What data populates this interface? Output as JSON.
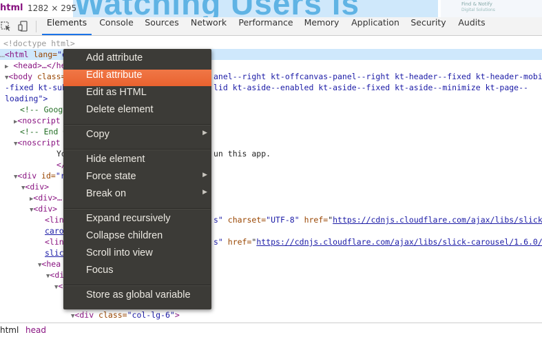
{
  "hover_tooltip": {
    "tag": "html",
    "dims": "1282 × 295"
  },
  "page_behind": {
    "headline": "Watching Users is",
    "logo_line1": "Find & Notify",
    "logo_line2": "Digital Solutions"
  },
  "toolbar": {
    "inspect_icon": "inspect-element-icon",
    "device_icon": "device-toolbar-icon",
    "tabs": [
      "Elements",
      "Console",
      "Sources",
      "Network",
      "Performance",
      "Memory",
      "Application",
      "Security",
      "Audits"
    ],
    "active_tab": "Elements"
  },
  "tree": {
    "l0": "<!doctype html>",
    "l1_tag": "<html",
    "l1_attr": " lang=",
    "l1_val": "\"en",
    "l2": "<head>…</hea",
    "l3_tag": "<body",
    "l3_attr": " class=",
    "l3_rest": "anel--right kt-offcanvas-panel--right kt-header--fixed kt-header-mobile-",
    "l4_left": "-fixed kt-sub",
    "l4_rest": "lid kt-aside--enabled kt-aside--fixed kt-aside--minimize kt-page--",
    "l5": "loading\">",
    "l6": "<!-- Googl",
    "l7": "<noscript",
    "l8": "<!-- End G",
    "l9": "<noscript",
    "l10_left": "Yo",
    "l10_rest": "un this app.",
    "l11": "</",
    "l12_tag": "<div",
    "l12_attr": " id=",
    "l12_val": "\"r",
    "l13": "<div>",
    "l14": "<div>…",
    "l15": "<div>",
    "l16_left": "<lin",
    "l16_q": "s\"",
    "l16_a1": " charset=",
    "l16_v1": "\"UTF-8\"",
    "l16_a2": " href=",
    "l16_link": "https://cdnjs.cloudflare.com/ajax/libs/slick-",
    "l17_left": "caro",
    "l18_left": "<lin",
    "l18_q": "s\"",
    "l18_a": " href=",
    "l18_link": "https://cdnjs.cloudflare.com/ajax/libs/slick-carousel/1.6.0/",
    "l19_left": "slic",
    "l20": "<hea",
    "l21": "<di",
    "l22": "<",
    "l23_tag": "<div",
    "l23_attr": " class=",
    "l23_val": "\"col-lg-6\"",
    "l23_end": ">"
  },
  "context_menu": {
    "items": [
      {
        "label": "Add attribute"
      },
      {
        "label": "Edit attribute"
      },
      {
        "label": "Edit as HTML"
      },
      {
        "label": "Delete element"
      },
      {
        "label": "Copy"
      },
      {
        "label": "Hide element"
      },
      {
        "label": "Force state"
      },
      {
        "label": "Break on"
      },
      {
        "label": "Expand recursively"
      },
      {
        "label": "Collapse children"
      },
      {
        "label": "Scroll into view"
      },
      {
        "label": "Focus"
      },
      {
        "label": "Store as global variable"
      }
    ],
    "highlighted": "Edit attribute",
    "highlight_color": "#e9622f"
  },
  "breadcrumb": [
    "html",
    "head"
  ]
}
